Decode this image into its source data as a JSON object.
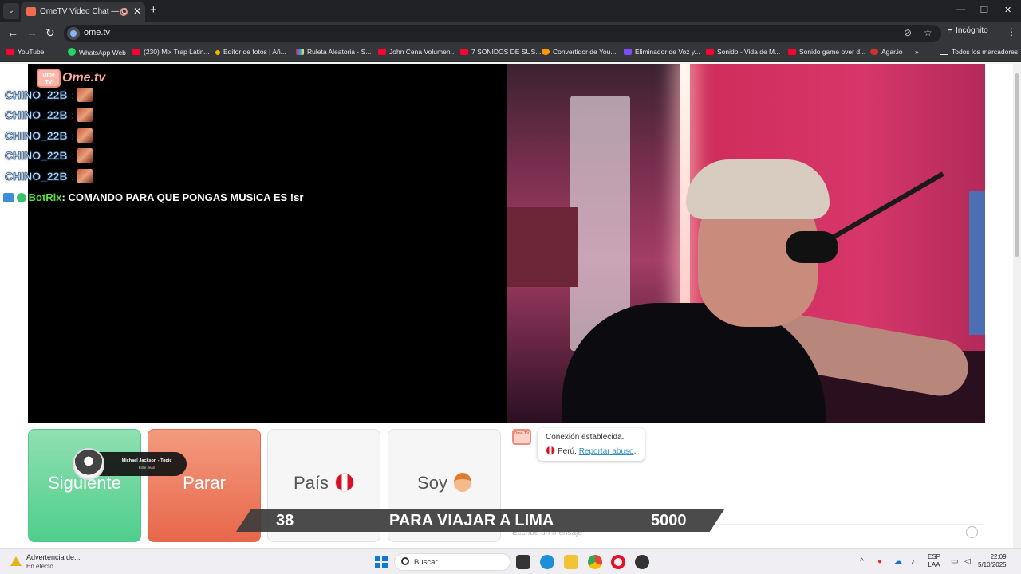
{
  "browser": {
    "tab_title": "OmeTV Video Chat — Ome...",
    "url": "ome.tv",
    "incognito_label": "Incógnito",
    "bookmarks": [
      {
        "label": "YouTube",
        "icon": "youtube-icon"
      },
      {
        "label": "WhatsApp Web",
        "icon": "whatsapp-icon"
      },
      {
        "label": "(230) Mix Trap Latin...",
        "icon": "youtube-icon"
      },
      {
        "label": "Editor de fotos | Añ...",
        "icon": "editor-icon"
      },
      {
        "label": "Ruleta Aleatoria - S...",
        "icon": "ruleta-icon"
      },
      {
        "label": "John Cena Volumen...",
        "icon": "youtube-icon"
      },
      {
        "label": "7 SONIDOS DE SUS...",
        "icon": "youtube-icon"
      },
      {
        "label": "Convertidor de You...",
        "icon": "converter-icon"
      },
      {
        "label": "Eliminador de Voz y...",
        "icon": "voice-remover-icon"
      },
      {
        "label": "Sonido - Vida de M...",
        "icon": "youtube-icon"
      },
      {
        "label": "Sonido game over d...",
        "icon": "youtube-icon"
      },
      {
        "label": "Agar.io",
        "icon": "agario-icon"
      }
    ],
    "all_bookmarks_label": "Todos los marcadores"
  },
  "stream_chat": {
    "messages": [
      {
        "user": "CHINO_22B",
        "sep": ":"
      },
      {
        "user": "CHINO_22B",
        "sep": ":"
      },
      {
        "user": "CHINO_22B",
        "sep": ":"
      },
      {
        "user": "CHINO_22B",
        "sep": ":"
      },
      {
        "user": "CHINO_22B",
        "sep": ":"
      }
    ],
    "bot": {
      "user": "BotRix",
      "text": ": COMANDO PARA QUE PONGAS MUSICA ES !sr"
    }
  },
  "logo": {
    "badge": "Ome TV",
    "text": "Ome.tv"
  },
  "buttons": {
    "next": "Siguiente",
    "stop": "Parar",
    "country": "País",
    "gender": "Soy"
  },
  "now_playing": {
    "title": "Michael Jackson - Topic",
    "subtitle": "Billie Jean"
  },
  "chat_panel": {
    "logo_badge": "Ome TV",
    "connection": "Conexión establecida.",
    "country": "Perú.",
    "report": "Reportar abuso",
    "report_suffix": ".",
    "input_placeholder": "Escribe un mensaje"
  },
  "banner": {
    "count": "38",
    "text": "PARA VIAJAR A LIMA",
    "goal": "5000"
  },
  "taskbar": {
    "notice_title": "Advertencia de...",
    "notice_sub": "En efecto",
    "search_label": "Buscar",
    "lang_1": "ESP",
    "lang_2": "LAA",
    "time": "22:09",
    "date": "5/10/2025"
  },
  "colors": {
    "next": "#4fce8c",
    "stop": "#e8674b",
    "bot_name": "#58e03f",
    "link": "#2f8fbf"
  }
}
